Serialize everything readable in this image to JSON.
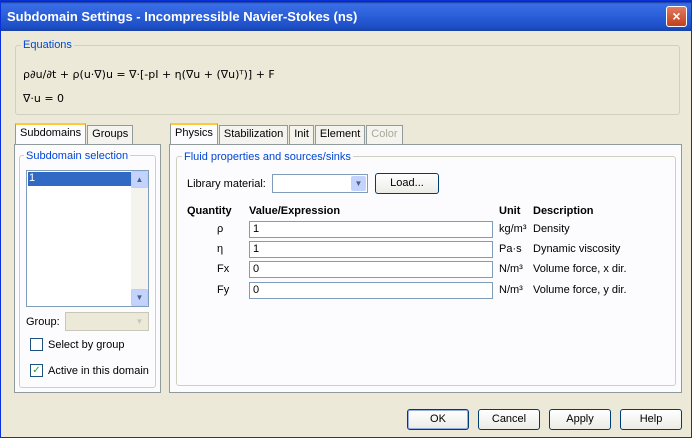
{
  "window": {
    "title": "Subdomain Settings - Incompressible Navier-Stokes (ns)",
    "close_label": "×"
  },
  "equations": {
    "legend": "Equations",
    "line1": "ρ∂u/∂t + ρ(u·∇)u = ∇·[-pI + η(∇u + (∇u)ᵀ)] + F",
    "line2": "∇·u = 0"
  },
  "left_tabs": [
    "Subdomains",
    "Groups"
  ],
  "subdomain_selection": {
    "legend": "Subdomain selection",
    "items": [
      "1"
    ],
    "selected": "1"
  },
  "group": {
    "label": "Group:",
    "value": ""
  },
  "select_by_group": {
    "label": "Select by group",
    "checked": false
  },
  "active_in_domain": {
    "label": "Active in this domain",
    "checked": true
  },
  "right_tabs": [
    "Physics",
    "Stabilization",
    "Init",
    "Element",
    "Color"
  ],
  "fluid": {
    "legend": "Fluid properties and sources/sinks",
    "library_label": "Library material:",
    "library_value": "",
    "load_label": "Load...",
    "headers": {
      "quantity": "Quantity",
      "value": "Value/Expression",
      "unit": "Unit",
      "description": "Description"
    },
    "rows": [
      {
        "quantity": "ρ",
        "value": "1",
        "unit": "kg/m³",
        "description": "Density"
      },
      {
        "quantity": "η",
        "value": "1",
        "unit": "Pa·s",
        "description": "Dynamic viscosity"
      },
      {
        "quantity": "Fx",
        "value": "0",
        "unit": "N/m³",
        "description": "Volume force, x dir."
      },
      {
        "quantity": "Fy",
        "value": "0",
        "unit": "N/m³",
        "description": "Volume force, y dir."
      }
    ]
  },
  "buttons": {
    "ok": "OK",
    "cancel": "Cancel",
    "apply": "Apply",
    "help": "Help"
  }
}
